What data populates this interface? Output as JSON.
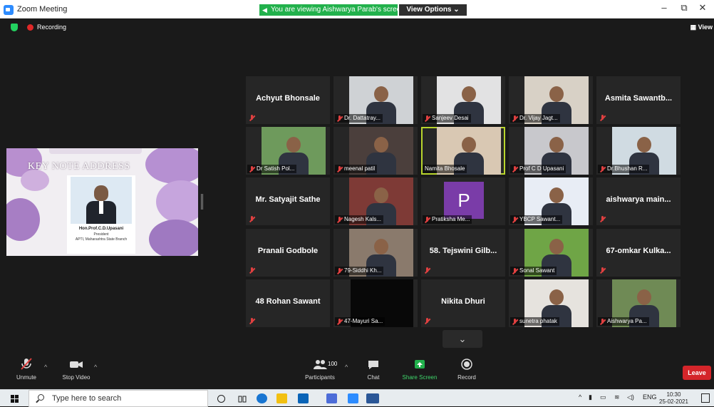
{
  "window": {
    "title": "Zoom Meeting",
    "share_banner": "You are viewing Aishwarya Parab's screen",
    "view_options": "View Options",
    "view_options_caret": "⌄",
    "minimize": "–",
    "maximize": "⧉",
    "close": "✕"
  },
  "status": {
    "recording_label": "Recording",
    "view_label": "View"
  },
  "shared_screen": {
    "heading": "KEY NOTE ADDRESS",
    "card_name": "Hon.Prof.C.D.Upasani",
    "card_role": "President",
    "card_org": "APTI, Maharashtra State Branch"
  },
  "gallery": {
    "tiles": [
      {
        "name": "Achyut Bhonsale",
        "type": "name"
      },
      {
        "name": "Dr. Dattatray...",
        "type": "video"
      },
      {
        "name": "Sanjeev Desai",
        "type": "video"
      },
      {
        "name": "Dr. Vijay Jagt...",
        "type": "video"
      },
      {
        "name": "Asmita Sawantb...",
        "type": "name"
      },
      {
        "name": "Dr Satish Pol...",
        "type": "video"
      },
      {
        "name": "meenal patil",
        "type": "video"
      },
      {
        "name": "Namita Bhosale",
        "type": "video",
        "active": true
      },
      {
        "name": "Prof C D Upasani",
        "type": "video"
      },
      {
        "name": "Dr.Bhushan R...",
        "type": "video"
      },
      {
        "name": "Mr. Satyajit Sathe",
        "type": "name"
      },
      {
        "name": "Nagesh Kals...",
        "type": "video"
      },
      {
        "name": "Pratiksha Me...",
        "type": "avatar",
        "letter": "P"
      },
      {
        "name": "YBCP Sawant...",
        "type": "video"
      },
      {
        "name": "aishwarya main...",
        "type": "name"
      },
      {
        "name": "Pranali Godbole",
        "type": "name"
      },
      {
        "name": "79-Siddhi Kh...",
        "type": "video"
      },
      {
        "name": "58. Tejswini Gilb...",
        "type": "name"
      },
      {
        "name": "Sonal Sawant",
        "type": "video"
      },
      {
        "name": "67-omkar Kulka...",
        "type": "name"
      },
      {
        "name": "48 Rohan Sawant",
        "type": "name"
      },
      {
        "name": "47-Mayuri Sa...",
        "type": "video"
      },
      {
        "name": "Nikita Dhuri",
        "type": "name"
      },
      {
        "name": "sunetra phatak",
        "type": "video"
      },
      {
        "name": "Aishwarya Pa...",
        "type": "video"
      }
    ],
    "next_page": "⌄"
  },
  "toolbar": {
    "unmute": "Unmute",
    "stop_video": "Stop Video",
    "participants": "Participants",
    "participant_count": "100",
    "chat": "Chat",
    "share_screen": "Share Screen",
    "record": "Record",
    "leave": "Leave",
    "caret": "^"
  },
  "taskbar": {
    "search_placeholder": "Type here to search",
    "language": "ENG",
    "time": "10:30",
    "date": "25-02-2021"
  },
  "colors": {
    "green": "#22b14c",
    "leave": "#d4252a",
    "active_speaker": "#b9d52d",
    "mute": "#e04040"
  }
}
